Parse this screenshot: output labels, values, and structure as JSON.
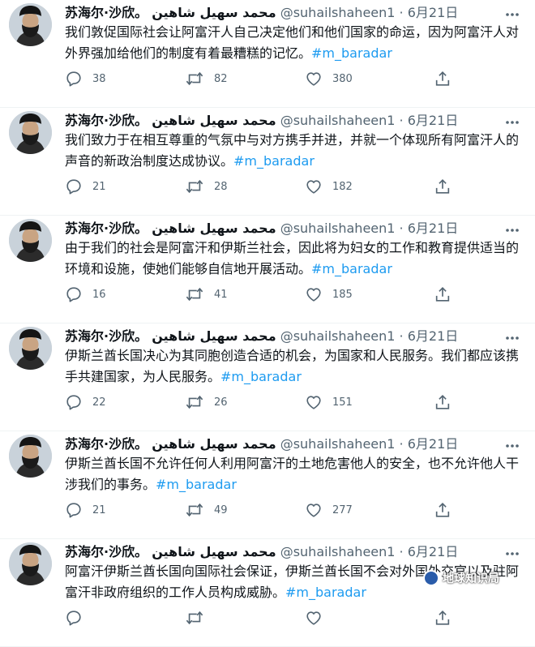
{
  "colors": {
    "link": "#1d9bf0",
    "meta": "#536471",
    "text": "#0f1419",
    "divider": "#eff3f4"
  },
  "tweets": [
    {
      "name": "苏海尔·沙欣。",
      "arabic_name": "محمد سهيل شاهين",
      "handle": "@suhailshaheen1",
      "separator": "·",
      "date": "6月21日",
      "text": "我们敦促国际社会让阿富汗人自己决定他们和他们国家的命运，因为阿富汗人对外界强加给他们的制度有着最糟糕的记忆。",
      "hashtag": "#m_baradar",
      "replies": "38",
      "retweets": "82",
      "likes": "380"
    },
    {
      "name": "苏海尔·沙欣。",
      "arabic_name": "محمد سهيل شاهين",
      "handle": "@suhailshaheen1",
      "separator": "·",
      "date": "6月21日",
      "text": "我们致力于在相互尊重的气氛中与对方携手并进，并就一个体现所有阿富汗人的声音的新政治制度达成协议。",
      "hashtag": "#m_baradar",
      "replies": "21",
      "retweets": "28",
      "likes": "182"
    },
    {
      "name": "苏海尔·沙欣。",
      "arabic_name": "محمد سهيل شاهين",
      "handle": "@suhailshaheen1",
      "separator": "·",
      "date": "6月21日",
      "text": "由于我们的社会是阿富汗和伊斯兰社会，因此将为妇女的工作和教育提供适当的环境和设施，使她们能够自信地开展活动。",
      "hashtag": "#m_baradar",
      "replies": "16",
      "retweets": "41",
      "likes": "185"
    },
    {
      "name": "苏海尔·沙欣。",
      "arabic_name": "محمد سهيل شاهين",
      "handle": "@suhailshaheen1",
      "separator": "·",
      "date": "6月21日",
      "text": "伊斯兰酋长国决心为其同胞创造合适的机会，为国家和人民服务。我们都应该携手共建国家，为人民服务。",
      "hashtag": "#m_baradar",
      "replies": "22",
      "retweets": "26",
      "likes": "151"
    },
    {
      "name": "苏海尔·沙欣。",
      "arabic_name": "محمد سهيل شاهين",
      "handle": "@suhailshaheen1",
      "separator": "·",
      "date": "6月21日",
      "text": "伊斯兰酋长国不允许任何人利用阿富汗的土地危害他人的安全，也不允许他人干涉我们的事务。",
      "hashtag": "#m_baradar",
      "replies": "21",
      "retweets": "49",
      "likes": "277"
    },
    {
      "name": "苏海尔·沙欣。",
      "arabic_name": "محمد سهيل شاهين",
      "handle": "@suhailshaheen1",
      "separator": "·",
      "date": "6月21日",
      "text": "阿富汗伊斯兰酋长国向国际社会保证，伊斯兰酋长国不会对外国外交官以及驻阿富汗非政府组织的工作人员构成威胁。",
      "hashtag": "#m_baradar",
      "replies": "",
      "retweets": "",
      "likes": ""
    }
  ],
  "watermark": {
    "text": "地球知识局"
  }
}
